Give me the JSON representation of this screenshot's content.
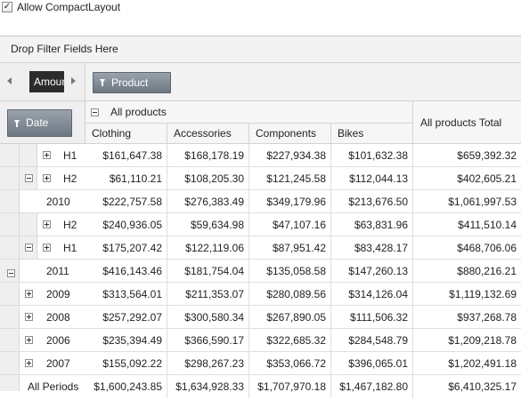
{
  "option": {
    "label": "Allow CompactLayout",
    "checked": true,
    "check_glyph": "✓"
  },
  "pivot": {
    "filter_area_label": "Drop Filter Fields Here",
    "data_field": "Amount",
    "column_field": "Product",
    "row_field": "Date",
    "column_group": "All products",
    "columns": [
      "Clothing",
      "Accessories",
      "Components",
      "Bikes"
    ],
    "total_column": "All products Total",
    "rows": [
      {
        "label": "H1",
        "values": [
          "$161,647.38",
          "$168,178.19",
          "$227,934.38",
          "$101,632.38",
          "$659,392.32"
        ]
      },
      {
        "label": "H2",
        "values": [
          "$61,110.21",
          "$108,205.30",
          "$121,245.58",
          "$112,044.13",
          "$402,605.21"
        ]
      },
      {
        "label": "2010",
        "values": [
          "$222,757.58",
          "$276,383.49",
          "$349,179.96",
          "$213,676.50",
          "$1,061,997.53"
        ]
      },
      {
        "label": "H2",
        "values": [
          "$240,936.05",
          "$59,634.98",
          "$47,107.16",
          "$63,831.96",
          "$411,510.14"
        ]
      },
      {
        "label": "H1",
        "values": [
          "$175,207.42",
          "$122,119.06",
          "$87,951.42",
          "$83,428.17",
          "$468,706.06"
        ]
      },
      {
        "label": "2011",
        "values": [
          "$416,143.46",
          "$181,754.04",
          "$135,058.58",
          "$147,260.13",
          "$880,216.21"
        ]
      },
      {
        "label": "2009",
        "values": [
          "$313,564.01",
          "$211,353.07",
          "$280,089.56",
          "$314,126.04",
          "$1,119,132.69"
        ]
      },
      {
        "label": "2008",
        "values": [
          "$257,292.07",
          "$300,580.34",
          "$267,890.05",
          "$111,506.32",
          "$937,268.78"
        ]
      },
      {
        "label": "2006",
        "values": [
          "$235,394.49",
          "$366,590.17",
          "$322,685.32",
          "$284,548.79",
          "$1,209,218.78"
        ]
      },
      {
        "label": "2007",
        "values": [
          "$155,092.22",
          "$298,267.23",
          "$353,066.72",
          "$396,065.01",
          "$1,202,491.18"
        ]
      },
      {
        "label": "All Periods",
        "values": [
          "$1,600,243.85",
          "$1,634,928.33",
          "$1,707,970.18",
          "$1,467,182.80",
          "$6,410,325.17"
        ]
      }
    ]
  }
}
